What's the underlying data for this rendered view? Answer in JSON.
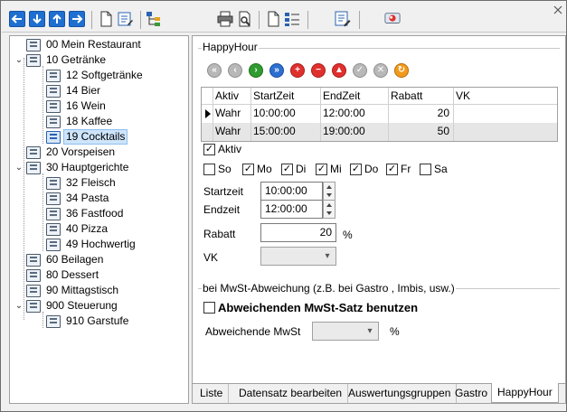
{
  "tree": {
    "items": [
      {
        "label": "00 Mein Restaurant"
      },
      {
        "label": "10 Getränke"
      },
      {
        "label": "12 Softgetränke"
      },
      {
        "label": "14 Bier"
      },
      {
        "label": "16 Wein"
      },
      {
        "label": "18 Kaffee"
      },
      {
        "label": "19 Cocktails"
      },
      {
        "label": "20 Vorspeisen"
      },
      {
        "label": "30 Hauptgerichte"
      },
      {
        "label": "32 Fleisch"
      },
      {
        "label": "34 Pasta"
      },
      {
        "label": "36 Fastfood"
      },
      {
        "label": "40 Pizza"
      },
      {
        "label": "49 Hochwertig"
      },
      {
        "label": "60 Beilagen"
      },
      {
        "label": "80 Dessert"
      },
      {
        "label": "90 Mittagstisch"
      },
      {
        "label": "900 Steuerung"
      },
      {
        "label": "910 Garstufe"
      }
    ],
    "selected": "19 Cocktails"
  },
  "happyhour": {
    "group_title": "HappyHour",
    "grid": {
      "columns": [
        "Aktiv",
        "StartZeit",
        "EndZeit",
        "Rabatt",
        "VK"
      ],
      "rows": [
        [
          "Wahr",
          "10:00:00",
          "12:00:00",
          "20",
          ""
        ],
        [
          "Wahr",
          "15:00:00",
          "19:00:00",
          "50",
          ""
        ]
      ]
    },
    "aktiv_label": "Aktiv",
    "days": [
      {
        "label": "So",
        "checked": false
      },
      {
        "label": "Mo",
        "checked": true
      },
      {
        "label": "Di",
        "checked": true
      },
      {
        "label": "Mi",
        "checked": true
      },
      {
        "label": "Do",
        "checked": true
      },
      {
        "label": "Fr",
        "checked": true
      },
      {
        "label": "Sa",
        "checked": false
      }
    ],
    "startzeit_label": "Startzeit",
    "startzeit_value": "10:00:00",
    "endzeit_label": "Endzeit",
    "endzeit_value": "12:00:00",
    "rabatt_label": "Rabatt",
    "rabatt_value": "20",
    "rabatt_unit": "%",
    "vk_label": "VK"
  },
  "mwst": {
    "group_title": "bei MwSt-Abweichung (z.B. bei  Gastro , Imbis, usw.)",
    "checkbox_label": "Abweichenden MwSt-Satz benutzen",
    "field_label": "Abweichende MwSt",
    "unit": "%"
  },
  "tabs": [
    "Liste",
    "Datensatz bearbeiten",
    "Auswertungsgruppen",
    "Gastro",
    "HappyHour"
  ],
  "active_tab": "HappyHour"
}
